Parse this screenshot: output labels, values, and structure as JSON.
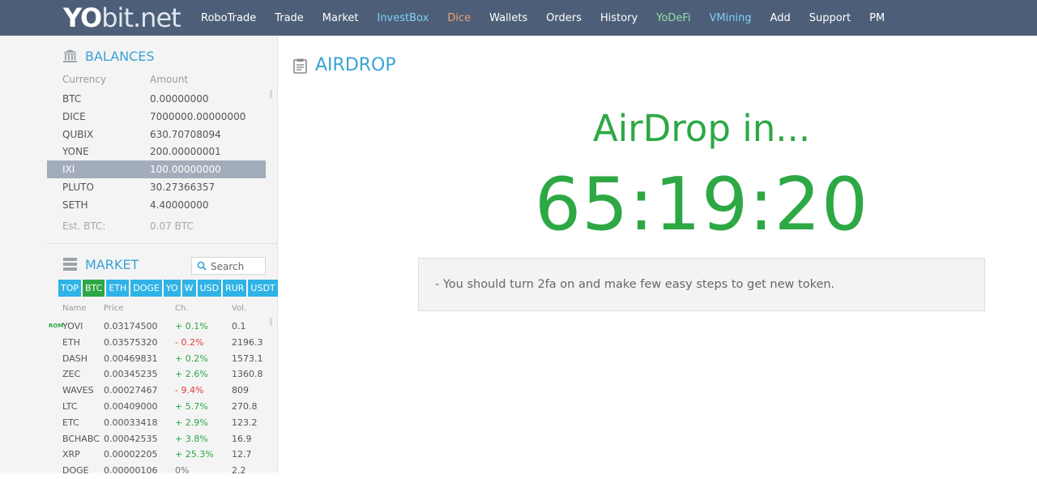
{
  "logo": {
    "yo": "YO",
    "rest": "bit.net"
  },
  "nav": [
    {
      "label": "RoboTrade",
      "color": "#ffffff"
    },
    {
      "label": "Trade",
      "color": "#ffffff"
    },
    {
      "label": "Market",
      "color": "#ffffff"
    },
    {
      "label": "InvestBox",
      "color": "#7fd0f5"
    },
    {
      "label": "Dice",
      "color": "#f0a070"
    },
    {
      "label": "Wallets",
      "color": "#ffffff"
    },
    {
      "label": "Orders",
      "color": "#ffffff"
    },
    {
      "label": "History",
      "color": "#ffffff"
    },
    {
      "label": "YoDeFi",
      "color": "#8fe0a8"
    },
    {
      "label": "VMining",
      "color": "#7fd0f5"
    },
    {
      "label": "Add",
      "color": "#ffffff"
    },
    {
      "label": "Support",
      "color": "#ffffff"
    },
    {
      "label": "PM",
      "color": "#ffffff"
    }
  ],
  "balances": {
    "title": "BALANCES",
    "col_currency": "Currency",
    "col_amount": "Amount",
    "rows": [
      {
        "currency": "BTC",
        "amount": "0.00000000",
        "selected": false
      },
      {
        "currency": "DICE",
        "amount": "7000000.00000000",
        "selected": false
      },
      {
        "currency": "QUBIX",
        "amount": "630.70708094",
        "selected": false
      },
      {
        "currency": "YONE",
        "amount": "200.00000001",
        "selected": false
      },
      {
        "currency": "IXI",
        "amount": "100.00000000",
        "selected": true
      },
      {
        "currency": "PLUTO",
        "amount": "30.27366357",
        "selected": false
      },
      {
        "currency": "SETH",
        "amount": "4.40000000",
        "selected": false
      }
    ],
    "est_label": "Est. BTC:",
    "est_value": "0.07 BTC"
  },
  "market": {
    "title": "MARKET",
    "search_label": "Search",
    "tabs": [
      {
        "label": "TOP",
        "active": false
      },
      {
        "label": "BTC",
        "active": true
      },
      {
        "label": "ETH",
        "active": false
      },
      {
        "label": "DOGE",
        "active": false
      },
      {
        "label": "YO",
        "active": false
      },
      {
        "label": "W",
        "active": false
      },
      {
        "label": "USD",
        "active": false
      },
      {
        "label": "RUR",
        "active": false
      },
      {
        "label": "USDT",
        "active": false
      }
    ],
    "col_name": "Name",
    "col_price": "Price",
    "col_change": "Ch.",
    "col_volume": "Vol.",
    "rows": [
      {
        "badge": "ROM",
        "name": "YOVI",
        "price": "0.03174500",
        "change": "+ 0.1%",
        "dir": "up",
        "volume": "0.1"
      },
      {
        "badge": "",
        "name": "ETH",
        "price": "0.03575320",
        "change": "- 0.2%",
        "dir": "down",
        "volume": "2196.3"
      },
      {
        "badge": "",
        "name": "DASH",
        "price": "0.00469831",
        "change": "+ 0.2%",
        "dir": "up",
        "volume": "1573.1"
      },
      {
        "badge": "",
        "name": "ZEC",
        "price": "0.00345235",
        "change": "+ 2.6%",
        "dir": "up",
        "volume": "1360.8"
      },
      {
        "badge": "",
        "name": "WAVES",
        "price": "0.00027467",
        "change": "- 9.4%",
        "dir": "down",
        "volume": "809"
      },
      {
        "badge": "",
        "name": "LTC",
        "price": "0.00409000",
        "change": "+ 5.7%",
        "dir": "up",
        "volume": "270.8"
      },
      {
        "badge": "",
        "name": "ETC",
        "price": "0.00033418",
        "change": "+ 2.9%",
        "dir": "up",
        "volume": "123.2"
      },
      {
        "badge": "",
        "name": "BCHABC",
        "price": "0.00042535",
        "change": "+ 3.8%",
        "dir": "up",
        "volume": "16.9"
      },
      {
        "badge": "",
        "name": "XRP",
        "price": "0.00002205",
        "change": "+ 25.3%",
        "dir": "up",
        "volume": "12.7"
      },
      {
        "badge": "",
        "name": "DOGE",
        "price": "0.00000106",
        "change": "0%",
        "dir": "flat",
        "volume": "2.2"
      }
    ]
  },
  "main": {
    "title": "AIRDROP",
    "heading": "AirDrop in...",
    "countdown": "65:19:20",
    "notice": "- You should turn 2fa on and make few easy steps to get new token."
  },
  "colors": {
    "topbar": "#4d5f78",
    "accent_blue": "#3aa3d6",
    "green": "#2da844",
    "red": "#e23b3b",
    "tab_blue": "#2fb3e6",
    "selected_row": "#a2acbb"
  }
}
